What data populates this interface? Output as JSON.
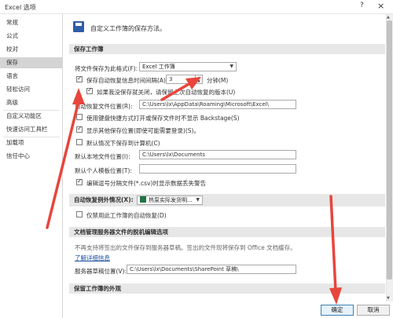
{
  "window": {
    "title": "Excel 选项",
    "help_glyph": "?",
    "close_glyph": "×"
  },
  "sidebar": {
    "items": [
      {
        "label": "常规"
      },
      {
        "label": "公式"
      },
      {
        "label": "校对"
      },
      {
        "label": "保存"
      },
      {
        "label": "语言"
      },
      {
        "label": "轻松访问"
      },
      {
        "label": "高级"
      },
      {
        "label": "自定义功能区"
      },
      {
        "label": "快速访问工具栏"
      },
      {
        "label": "加载项"
      },
      {
        "label": "信任中心"
      }
    ],
    "active_index": 3
  },
  "header": {
    "text": "自定义工作簿的保存方法。",
    "icon": "save-disk-icon"
  },
  "save_workbook": {
    "section_title": "保存工作簿",
    "format_label": "将文件保存为此格式(F):",
    "format_value": "Excel 工作簿",
    "autorecover_label": "保存自动恢复信息时间间隔(A)",
    "autorecover_checked": true,
    "autorecover_minutes": "3",
    "minutes_label": "分钟(M)",
    "keep_last_label": "如果我没保存就关闭，请保留上次自动恢复的版本(U)",
    "keep_last_checked": true,
    "autorecover_location_label": "自动恢复文件位置(R):",
    "autorecover_location_value": "C:\\Users\\lx\\AppData\\Roaming\\Microsoft\\Excel\\",
    "backstage_label": "使用键盘快捷方式打开或保存文件时不显示 Backstage(S)",
    "backstage_checked": false,
    "show_more_label": "显示其他保存位置(即使可能需要登录)(S)。",
    "show_more_checked": true,
    "default_computer_label": "默认情况下保存到计算机(C)",
    "default_computer_checked": false,
    "default_local_label": "默认本地文件位置(I):",
    "default_local_value": "C:\\Users\\lx\\Documents",
    "default_template_label": "默认个人模板位置(T):",
    "default_template_value": "",
    "csv_label": "编辑逗号分隔文件(*.csv)时显示数据丢失警告",
    "csv_checked": true
  },
  "autorecover_exceptions": {
    "label": "自动恢复例外情况(X):",
    "workbook_value": "热泵实际发货明...",
    "disable_label": "仅禁用此工作簿的自动恢复(D)",
    "disable_checked": false
  },
  "offline": {
    "section_title": "文档管理服务器文件的脱机编辑选项",
    "description": "不再支持将签出的文件保存到服务器草稿。签出的文件现将保存到 Office 文档缓存。",
    "learn_more": "了解详细信息",
    "drafts_label": "服务器草稿位置(V):",
    "drafts_value": "C:\\Users\\lx\\Documents\\SharePoint 草稿\\"
  },
  "appearance": {
    "section_title": "保留工作簿的外观"
  },
  "footer": {
    "ok_label": "确定",
    "cancel_label": "取消"
  },
  "annotation_color": "#e8453c"
}
